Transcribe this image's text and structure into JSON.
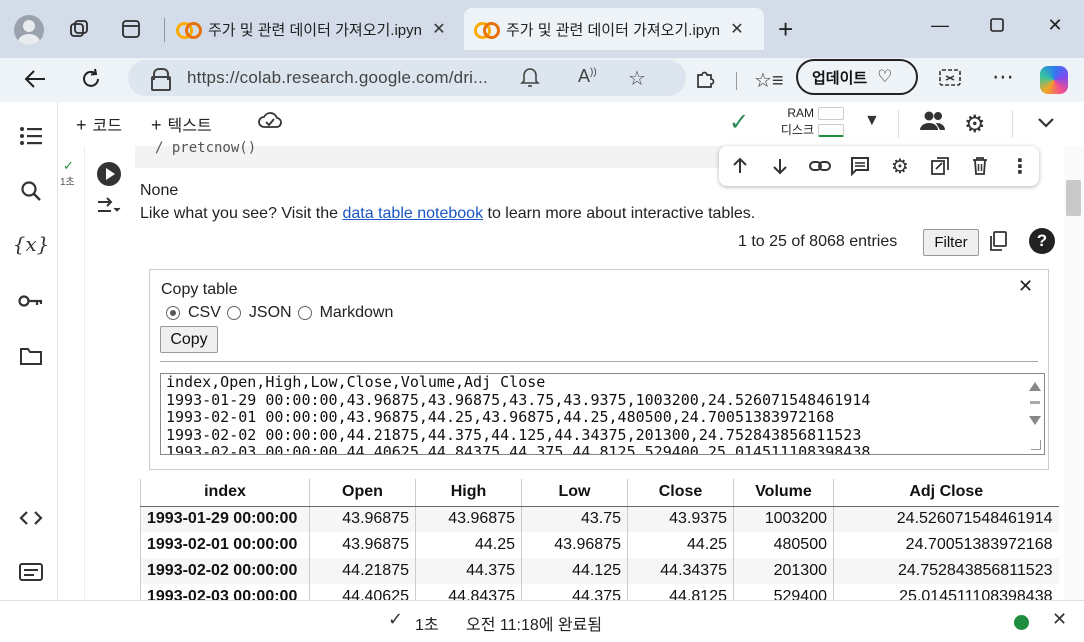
{
  "browser": {
    "tabs": [
      {
        "title": "주가 및 관련 데이터 가져오기.ipynb",
        "close": "✕"
      },
      {
        "title": "주가 및 관련 데이터 가져오기.ipynb",
        "close": "✕"
      }
    ],
    "url": "https://colab.research.google.com/dri...",
    "update_label": "업데이트"
  },
  "colab": {
    "toolbar": {
      "code_label": "코드",
      "text_label": "텍스트",
      "ram_label": "RAM",
      "disk_label": "디스크"
    },
    "cell": {
      "exec_time": "1초",
      "code_fragment": "/ pretcnow()",
      "output_none": "None",
      "output_like_pre": "Like what you see? Visit the ",
      "output_like_link": "data table notebook",
      "output_like_post": " to learn more about interactive tables.",
      "entries": "1 to 25 of 8068 entries",
      "filter_label": "Filter",
      "help": "?"
    },
    "copy_panel": {
      "title": "Copy table",
      "close": "✕",
      "options": [
        "CSV",
        "JSON",
        "Markdown"
      ],
      "selected": "CSV",
      "copy_label": "Copy",
      "csv_lines": [
        "index,Open,High,Low,Close,Volume,Adj Close",
        "1993-01-29 00:00:00,43.96875,43.96875,43.75,43.9375,1003200,24.526071548461914",
        "1993-02-01 00:00:00,43.96875,44.25,43.96875,44.25,480500,24.70051383972168",
        "1993-02-02 00:00:00,44.21875,44.375,44.125,44.34375,201300,24.752843856811523",
        "1993-02-03 00:00:00,44.40625,44.84375,44.375,44.8125,529400,25.014511108398438"
      ]
    },
    "table": {
      "columns": [
        "index",
        "Open",
        "High",
        "Low",
        "Close",
        "Volume",
        "Adj Close"
      ],
      "rows": [
        [
          "1993-01-29 00:00:00",
          "43.96875",
          "43.96875",
          "43.75",
          "43.9375",
          "1003200",
          "24.526071548461914"
        ],
        [
          "1993-02-01 00:00:00",
          "43.96875",
          "44.25",
          "43.96875",
          "44.25",
          "480500",
          "24.70051383972168"
        ],
        [
          "1993-02-02 00:00:00",
          "44.21875",
          "44.375",
          "44.125",
          "44.34375",
          "201300",
          "24.752843856811523"
        ],
        [
          "1993-02-03 00:00:00",
          "44.40625",
          "44.84375",
          "44.375",
          "44.8125",
          "529400",
          "25.014511108398438"
        ]
      ]
    },
    "status": {
      "time": "1초",
      "completed": "오전 11:18에 완료됨"
    }
  },
  "colors": {
    "accent_green": "#1e8e3e",
    "link": "#1a56c4",
    "colab_orange": "#f9ab00"
  }
}
